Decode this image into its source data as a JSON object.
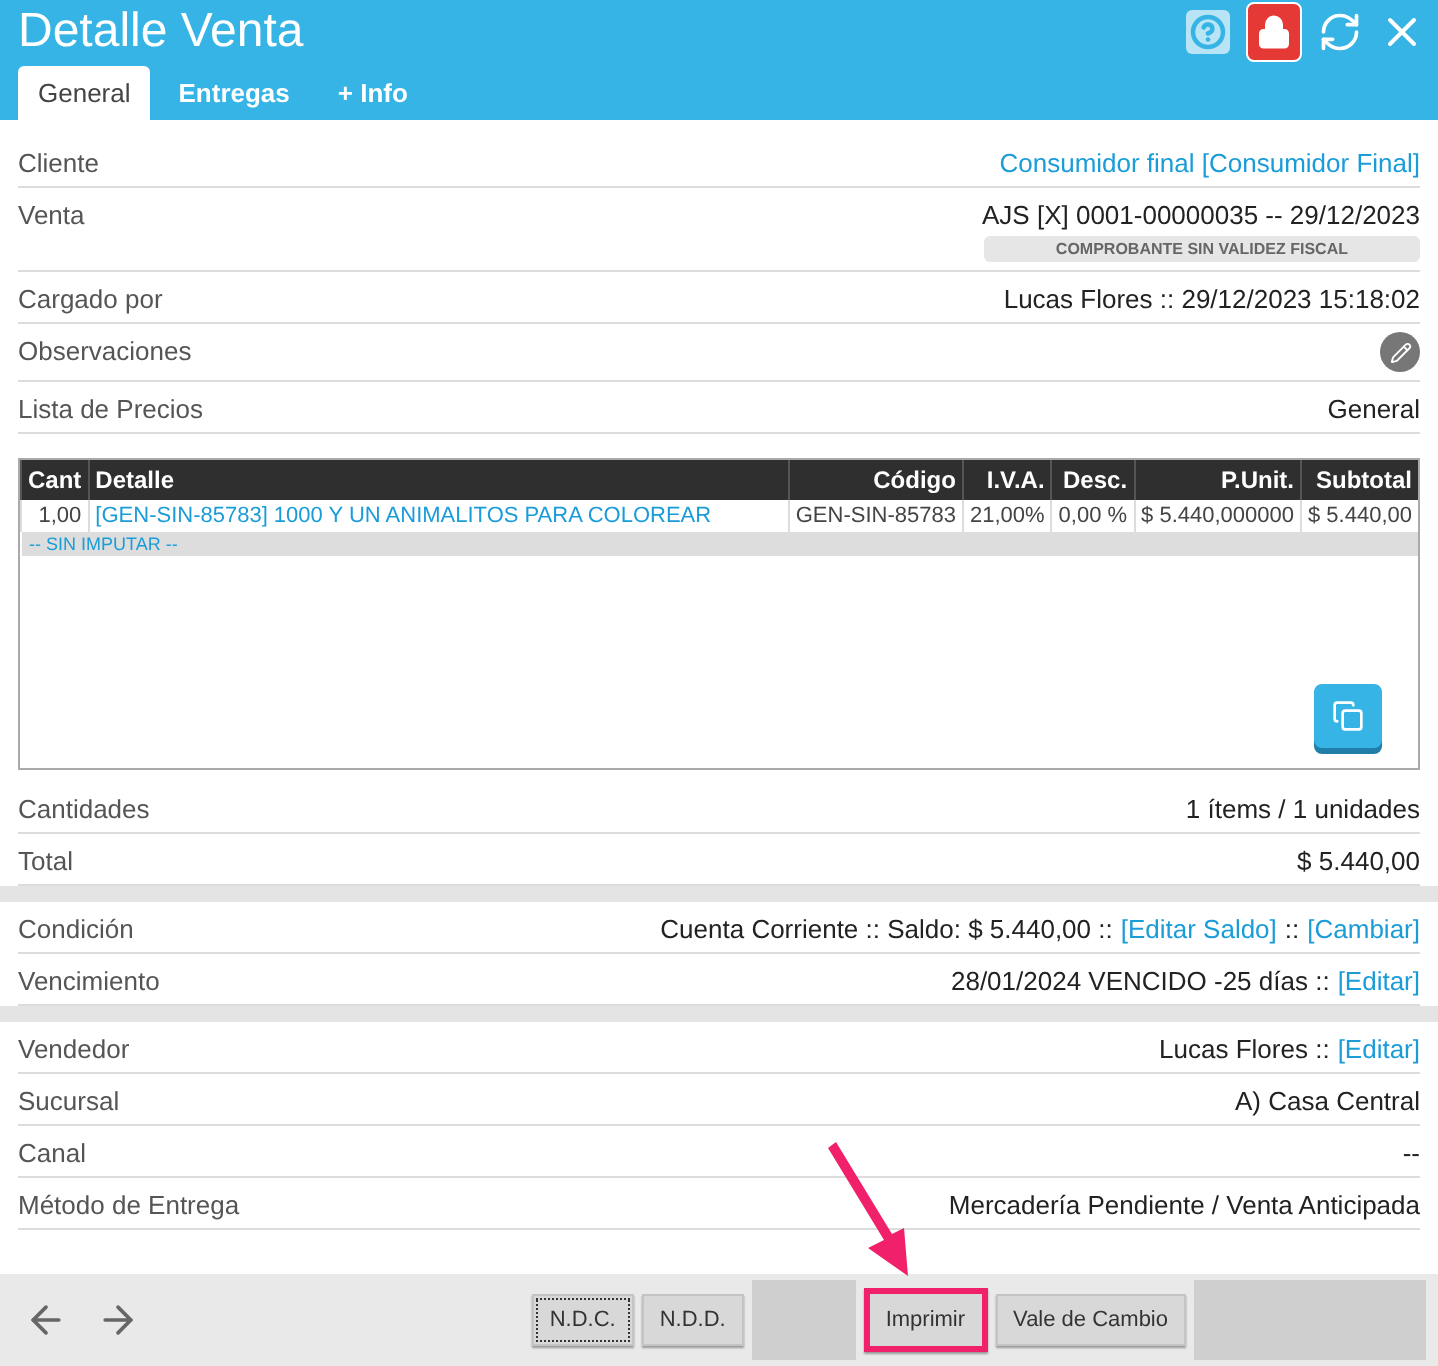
{
  "window": {
    "title": "Detalle Venta"
  },
  "tabs": [
    {
      "label": "General",
      "selected": true
    },
    {
      "label": "Entregas",
      "selected": false
    },
    {
      "label": "+ Info",
      "selected": false
    }
  ],
  "sections": [
    {
      "kind": "fields",
      "rows": [
        {
          "label": "Cliente",
          "value": [
            {
              "kind": "link",
              "text": "Consumidor final [Consumidor Final]"
            }
          ]
        },
        {
          "label": "Venta",
          "value": [
            {
              "kind": "text",
              "text": "AJS [X] 0001-00000035 -- 29/12/2023"
            }
          ],
          "badge": "COMPROBANTE SIN VALIDEZ FISCAL"
        },
        {
          "label": "Cargado por",
          "value": [
            {
              "kind": "text",
              "text": "Lucas Flores :: 29/12/2023 15:18:02"
            }
          ]
        },
        {
          "label": "Observaciones",
          "kind": "edit"
        },
        {
          "label": "Lista de Precios",
          "value": [
            {
              "kind": "text",
              "text": "General"
            }
          ]
        }
      ]
    },
    {
      "kind": "table",
      "columns": [
        "Cant",
        "Detalle",
        "Código",
        "I.V.A.",
        "Desc.",
        "P.Unit.",
        "Subtotal"
      ],
      "rows": [
        {
          "cells": [
            {
              "kind": "text",
              "text": "1,00"
            },
            {
              "kind": "link",
              "text": "[GEN-SIN-85783] 1000 Y UN ANIMALITOS PARA COLOREAR"
            },
            {
              "kind": "text",
              "text": "GEN-SIN-85783"
            },
            {
              "kind": "text",
              "text": "21,00%"
            },
            {
              "kind": "text",
              "text": "0,00 %"
            },
            {
              "kind": "text",
              "text": "$ 5.440,000000"
            },
            {
              "kind": "text",
              "text": "$ 5.440,00"
            }
          ],
          "note": "-- SIN IMPUTAR --"
        }
      ]
    },
    {
      "kind": "fields",
      "rows": [
        {
          "label": "Cantidades",
          "value": [
            {
              "kind": "text",
              "text": "1 ítems / 1 unidades"
            }
          ]
        },
        {
          "label": "Total",
          "value": [
            {
              "kind": "text",
              "text": "$ 5.440,00"
            }
          ]
        }
      ]
    },
    {
      "kind": "fields",
      "rows": [
        {
          "label": "Condición",
          "value": [
            {
              "kind": "text",
              "text": "Cuenta Corriente :: Saldo: $ 5.440,00 ::"
            },
            {
              "kind": "link",
              "text": "[Editar Saldo]"
            },
            {
              "kind": "text",
              "text": "::"
            },
            {
              "kind": "link",
              "text": "[Cambiar]"
            }
          ]
        },
        {
          "label": "Vencimiento",
          "value": [
            {
              "kind": "text",
              "text": "28/01/2024 VENCIDO -25 días ::"
            },
            {
              "kind": "link",
              "text": "[Editar]"
            }
          ]
        }
      ]
    },
    {
      "kind": "fields",
      "rows": [
        {
          "label": "Vendedor",
          "value": [
            {
              "kind": "text",
              "text": "Lucas Flores ::"
            },
            {
              "kind": "link",
              "text": "[Editar]"
            }
          ]
        },
        {
          "label": "Sucursal",
          "value": [
            {
              "kind": "text",
              "text": "A) Casa Central"
            }
          ]
        },
        {
          "label": "Canal",
          "value": [
            {
              "kind": "text",
              "text": "--"
            }
          ]
        },
        {
          "label": "Método de Entrega",
          "value": [
            {
              "kind": "text",
              "text": "Mercadería Pendiente / Venta Anticipada"
            }
          ]
        }
      ]
    }
  ],
  "footer": {
    "buttons": [
      {
        "kind": "label",
        "label": "N.D.C.",
        "focused": true,
        "highlighted": false
      },
      {
        "kind": "label",
        "label": "N.D.D.",
        "focused": false,
        "highlighted": false
      },
      {
        "kind": "blank"
      },
      {
        "kind": "label",
        "label": "Imprimir",
        "focused": false,
        "highlighted": true
      },
      {
        "kind": "label",
        "label": "Vale de Cambio",
        "focused": false,
        "highlighted": false
      },
      {
        "kind": "wide"
      }
    ]
  }
}
